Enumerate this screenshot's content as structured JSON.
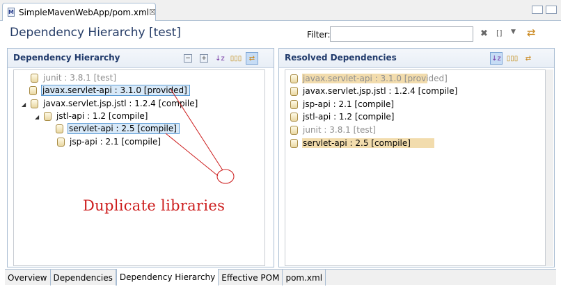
{
  "editor_tab": {
    "label": "SimpleMavenWebApp/pom.xml",
    "close": "☒"
  },
  "header": {
    "title": "Dependency Hierarchy [test]",
    "filter_label": "Filter:",
    "filter_value": ""
  },
  "left_panel": {
    "title": "Dependency Hierarchy",
    "items": [
      {
        "label": "junit : 3.8.1 [test]"
      },
      {
        "label": "javax.servlet-api : 3.1.0 [provided]"
      },
      {
        "label": "javax.servlet.jsp.jstl : 1.2.4 [compile]"
      },
      {
        "label": "jstl-api : 1.2 [compile]"
      },
      {
        "label": "servlet-api : 2.5 [compile]"
      },
      {
        "label": "jsp-api : 2.1 [compile]"
      }
    ]
  },
  "right_panel": {
    "title": "Resolved Dependencies",
    "items": [
      {
        "label": "javax.servlet-api : 3.1.0 [provided]"
      },
      {
        "label": "javax.servlet.jsp.jstl : 1.2.4 [compile]"
      },
      {
        "label": "jsp-api : 2.1 [compile]"
      },
      {
        "label": "jstl-api : 1.2 [compile]"
      },
      {
        "label": "junit : 3.8.1 [test]"
      },
      {
        "label": "servlet-api : 2.5 [compile]"
      }
    ]
  },
  "annotation": "Duplicate libraries",
  "bottom_tabs": [
    {
      "label": "Overview"
    },
    {
      "label": "Dependencies"
    },
    {
      "label": "Dependency Hierarchy"
    },
    {
      "label": "Effective POM"
    },
    {
      "label": "pom.xml"
    }
  ],
  "colors": {
    "annotation": "#cc1b1b",
    "highlight": "#f2dcad",
    "selection": "#d8e9f8",
    "title": "#243b66"
  }
}
